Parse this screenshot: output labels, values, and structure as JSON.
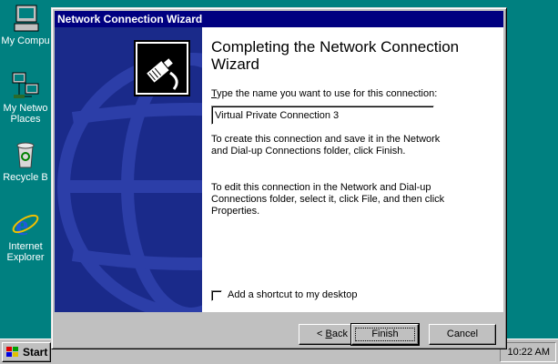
{
  "desktop": {
    "icons": [
      {
        "label": "My Compu",
        "icon": "my-computer-icon"
      },
      {
        "label": "My Netwo\nPlaces",
        "icon": "network-places-icon"
      },
      {
        "label": "Recycle B",
        "icon": "recycle-bin-icon"
      },
      {
        "label": "Internet\nExplorer",
        "icon": "internet-explorer-icon"
      }
    ]
  },
  "taskbar": {
    "start_label": "Start",
    "clock": "10:22 AM"
  },
  "wizard": {
    "title": "Network Connection Wizard",
    "heading": "Completing the Network Connection Wizard",
    "prompt_prefix": "",
    "prompt_accel": "T",
    "prompt_rest": "ype the name you want to use for this connection:",
    "connection_name": "Virtual Private Connection 3",
    "paragraph1": "To create this connection and save it in the Network and Dial-up Connections folder, click Finish.",
    "paragraph2": "To edit this connection in the Network and Dial-up Connections folder, select it, click File, and then click Properties.",
    "shortcut_label": "Add a shortcut to my desktop",
    "shortcut_checked": false,
    "buttons": {
      "back_prefix": "< ",
      "back_accel": "B",
      "back_rest": "ack",
      "finish": "Finish",
      "cancel": "Cancel"
    },
    "panel_color": "#1a2a8a"
  }
}
